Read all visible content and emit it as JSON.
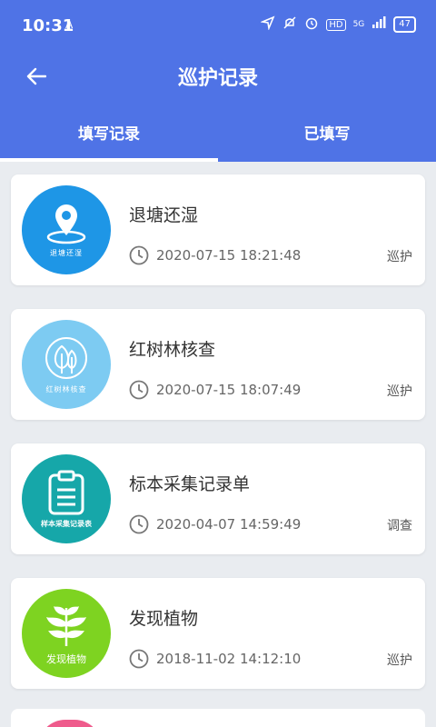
{
  "status": {
    "time": "10:31",
    "indicator": "A",
    "network": "5G",
    "battery": "47",
    "hd": "HD"
  },
  "navbar": {
    "title": "巡护记录"
  },
  "tabs": [
    {
      "label": "填写记录",
      "active": true
    },
    {
      "label": "已填写",
      "active": false
    }
  ],
  "records": [
    {
      "title": "退塘还湿",
      "time": "2020-07-15 18:21:48",
      "tag": "巡护",
      "icon_caption": "退塘还湿",
      "icon": "location-pin-icon",
      "color": "#1e96e6"
    },
    {
      "title": "红树林核查",
      "time": "2020-07-15 18:07:49",
      "tag": "巡护",
      "icon_caption": "红树林核查",
      "icon": "tree-icon",
      "color": "#7dcbf2"
    },
    {
      "title": "标本采集记录单",
      "time": "2020-04-07 14:59:49",
      "tag": "调查",
      "icon_caption": "样本采集记录表",
      "icon": "clipboard-icon",
      "color": "#16a7a9"
    },
    {
      "title": "发现植物",
      "time": "2018-11-02 14:12:10",
      "tag": "巡护",
      "icon_caption": "发现植物",
      "icon": "leaf-icon",
      "color": "#7ed321"
    }
  ],
  "colors": {
    "primary": "#4f73e6",
    "background": "#e9ecf0",
    "partial_card_icon": "#ef5b8c"
  }
}
